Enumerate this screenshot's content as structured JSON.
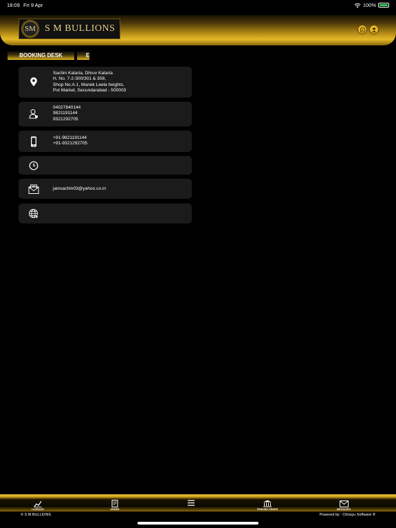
{
  "status_bar": {
    "time": "18:09",
    "date": "Fri 9 Apr",
    "battery": "100%"
  },
  "header": {
    "logo_mark": "SM",
    "brand_name": "S M BULLIONS"
  },
  "tabs": [
    {
      "label": "BOOKING DESK"
    },
    {
      "label": "E"
    }
  ],
  "contact": {
    "address": [
      "Sachin Kataria, Dhruv Kataria",
      "H. No. 7-2-300/301 & 308,",
      "Shop No.A.1, Manek Leela heights,",
      "Pot Market, Secundarabad - 500003"
    ],
    "landline": [
      "04027840144",
      "9821191144",
      "9321292705"
    ],
    "mobile": [
      "+91-9821191144",
      "+91-9321292705"
    ],
    "email": "jainsachin03@yahoo.co.in"
  },
  "bottom_nav": [
    {
      "label": "LIVERATE",
      "icon": "chart-icon"
    },
    {
      "label": "ORDER",
      "icon": "order-icon"
    },
    {
      "label": "",
      "icon": "menu-icon"
    },
    {
      "label": "PENDING ORDER",
      "icon": "bank-icon"
    },
    {
      "label": "MESSAGES",
      "icon": "mail-icon"
    }
  ],
  "footer": {
    "left": "© S M BULLIONS",
    "right": "Powered by : Chirayu Software ®"
  },
  "colors": {
    "gold": "#e6b92a",
    "card": "#1b1b1b",
    "background": "#000000"
  }
}
